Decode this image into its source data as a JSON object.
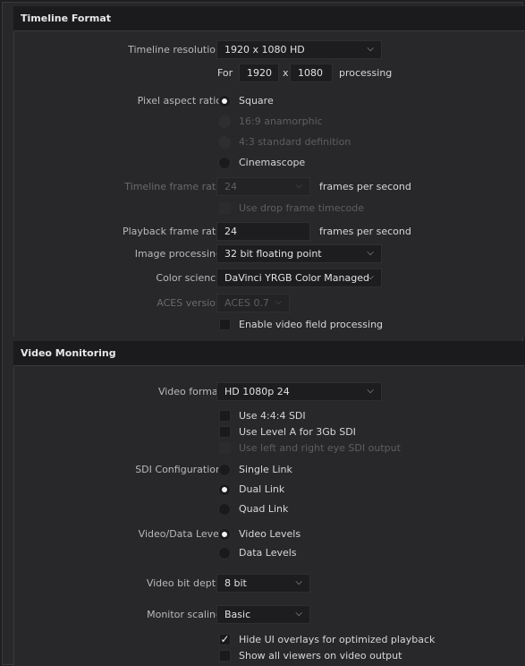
{
  "timeline_format": {
    "header": "Timeline Format",
    "timeline_resolution": {
      "label": "Timeline resolution",
      "value": "1920 x 1080 HD",
      "for_label": "For",
      "width": "1920",
      "x_label": "x",
      "height": "1080",
      "processing_label": "processing"
    },
    "pixel_aspect_ratio": {
      "label": "Pixel aspect ratio",
      "options": [
        "Square",
        "16:9 anamorphic",
        "4:3 standard definition",
        "Cinemascope"
      ]
    },
    "timeline_frame_rate": {
      "label": "Timeline frame rate",
      "value": "24",
      "unit": "frames per second",
      "drop_frame_label": "Use drop frame timecode"
    },
    "playback_frame_rate": {
      "label": "Playback frame rate",
      "value": "24",
      "unit": "frames per second"
    },
    "image_processing": {
      "label": "Image processing",
      "value": "32 bit floating point"
    },
    "color_science": {
      "label": "Color science",
      "value": "DaVinci YRGB Color Managed"
    },
    "aces_version": {
      "label": "ACES version",
      "value": "ACES 0.7"
    },
    "video_field_processing": "Enable video field processing"
  },
  "video_monitoring": {
    "header": "Video Monitoring",
    "video_format": {
      "label": "Video format",
      "value": "HD 1080p 24"
    },
    "checks": [
      "Use 4:4:4 SDI",
      "Use Level A for 3Gb SDI",
      "Use left and right eye SDI output"
    ],
    "sdi_configuration": {
      "label": "SDI Configuration",
      "options": [
        "Single Link",
        "Dual Link",
        "Quad Link"
      ]
    },
    "video_data_level": {
      "label": "Video/Data Level",
      "options": [
        "Video Levels",
        "Data Levels"
      ]
    },
    "video_bit_depth": {
      "label": "Video bit depth",
      "value": "8 bit"
    },
    "monitor_scaling": {
      "label": "Monitor scaling",
      "value": "Basic"
    },
    "hide_ui_overlays": "Hide UI overlays for optimized playback",
    "show_all_viewers": "Show all viewers on video output"
  },
  "icons": {
    "chevron": "chevron-down-icon",
    "checkmark": "✓"
  }
}
